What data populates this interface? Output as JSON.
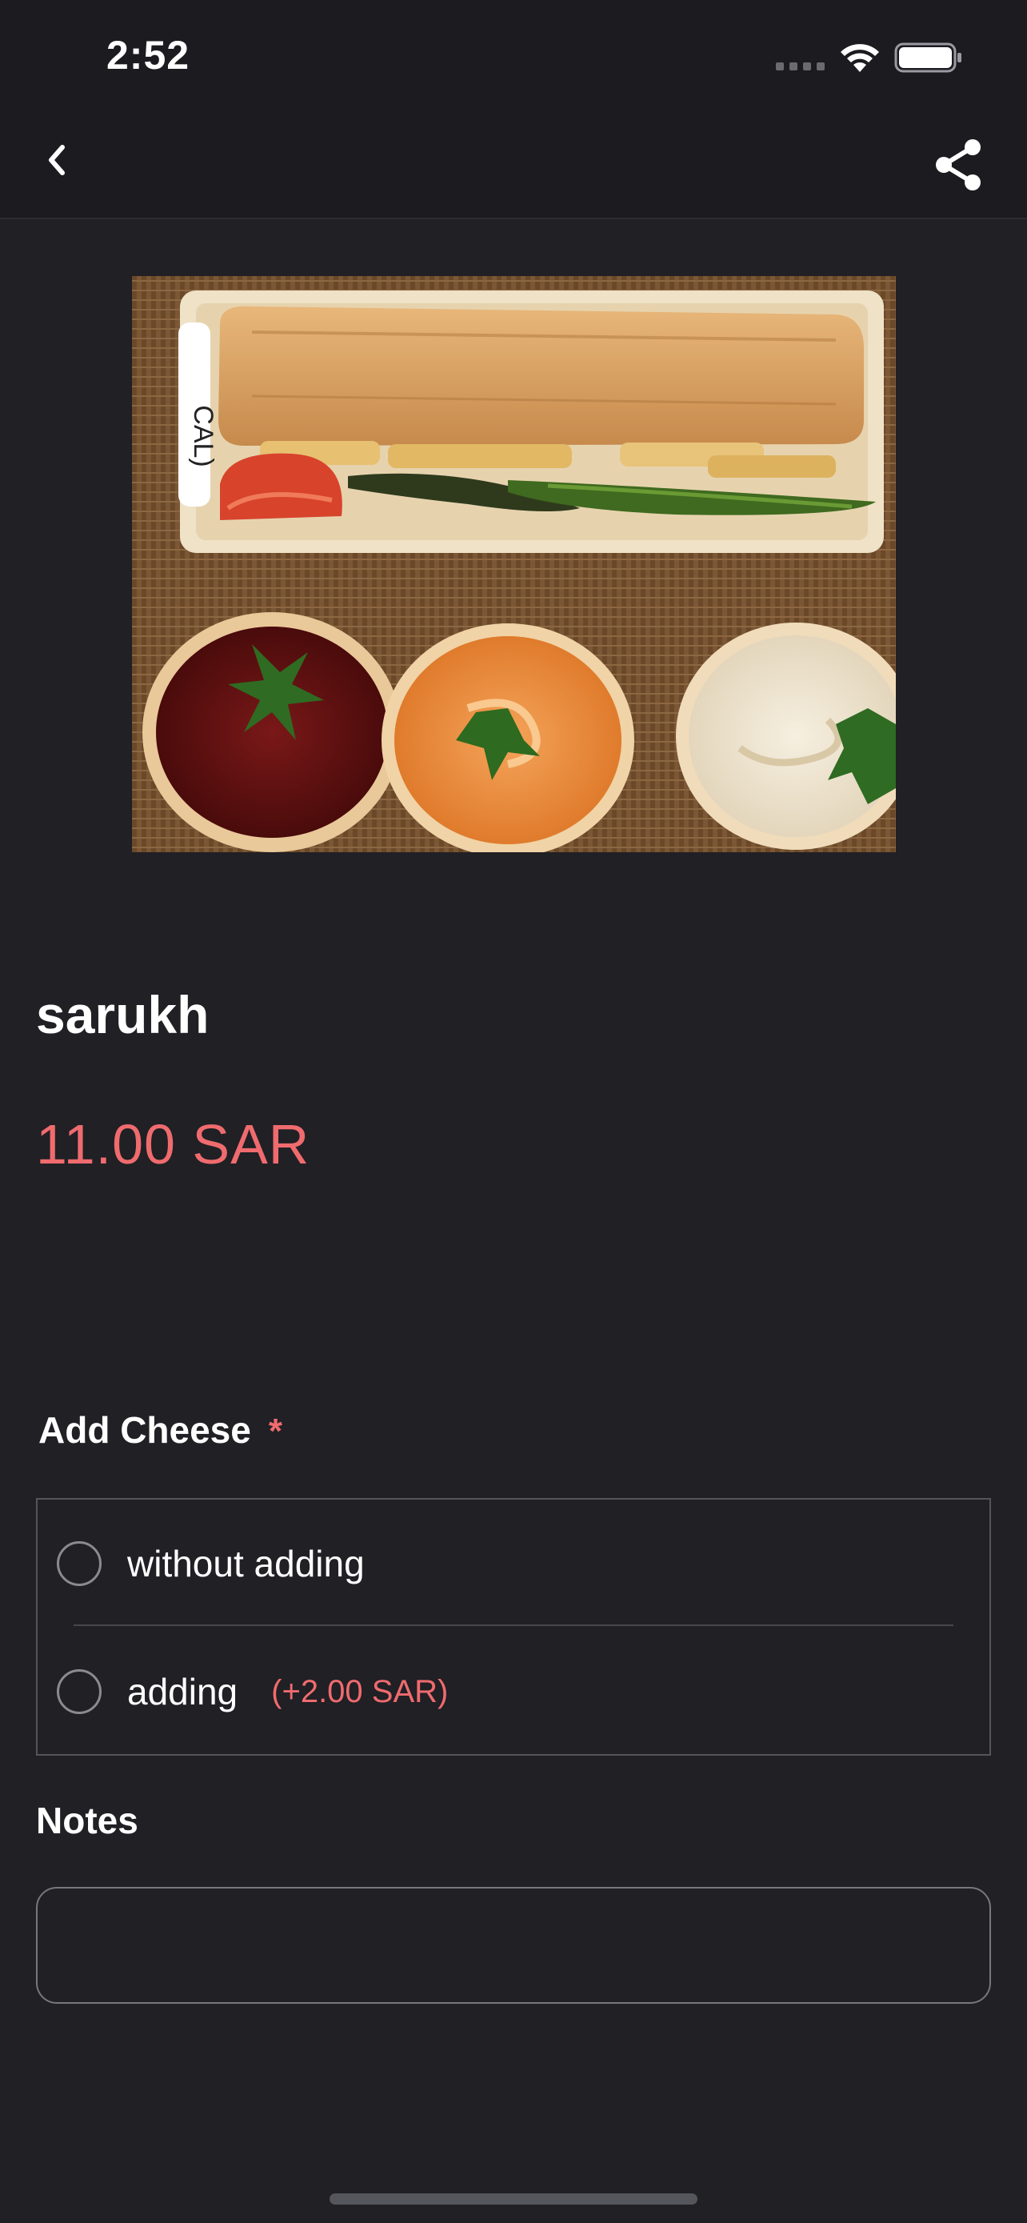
{
  "status_bar": {
    "time": "2:52"
  },
  "icons": {
    "back": "chevron-left-icon",
    "share": "share-icon",
    "wifi": "wifi-icon",
    "battery": "battery-icon"
  },
  "product": {
    "name": "sarukh",
    "price": "11.00 SAR",
    "image_caption": "CAL)"
  },
  "option_group": {
    "title": "Add Cheese",
    "required_mark": "*",
    "options": [
      {
        "label": "without adding",
        "price": ""
      },
      {
        "label": "adding",
        "price": "(+2.00 SAR)"
      }
    ]
  },
  "notes": {
    "label": "Notes",
    "value": ""
  },
  "colors": {
    "background": "#202025",
    "bar": "#1b1b20",
    "accent": "#ef6b6e"
  }
}
